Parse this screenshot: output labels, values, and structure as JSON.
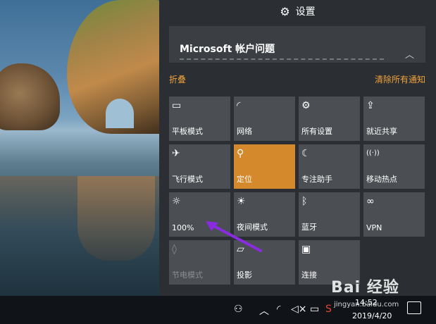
{
  "header": {
    "title": "设置",
    "gear_icon": "gear-icon"
  },
  "notification": {
    "title": "Microsoft 帐户问题",
    "chevron_icon": "chevron-up-icon"
  },
  "collapse": {
    "label": "折叠",
    "clear_all": "清除所有通知",
    "accent": "#f0a23b"
  },
  "tiles": [
    {
      "label": "平板模式",
      "icon": "tablet-mode-icon",
      "glyph": "▭",
      "active": false,
      "disabled": false
    },
    {
      "label": "网络",
      "icon": "network-icon",
      "glyph": "◜",
      "active": false,
      "disabled": false
    },
    {
      "label": "所有设置",
      "icon": "settings-icon",
      "glyph": "⚙",
      "active": false,
      "disabled": false
    },
    {
      "label": "就近共享",
      "icon": "share-icon",
      "glyph": "⇪",
      "active": false,
      "disabled": false
    },
    {
      "label": "飞行模式",
      "icon": "airplane-icon",
      "glyph": "✈",
      "active": false,
      "disabled": false
    },
    {
      "label": "定位",
      "icon": "location-icon",
      "glyph": "⚲",
      "active": true,
      "disabled": false
    },
    {
      "label": "专注助手",
      "icon": "moon-icon",
      "glyph": "☾",
      "active": false,
      "disabled": false
    },
    {
      "label": "移动热点",
      "icon": "hotspot-icon",
      "glyph": "((·))",
      "active": false,
      "disabled": false
    },
    {
      "label": "100%",
      "icon": "brightness-icon",
      "glyph": "☼",
      "active": false,
      "disabled": false
    },
    {
      "label": "夜间模式",
      "icon": "night-light-icon",
      "glyph": "☀",
      "active": false,
      "disabled": false
    },
    {
      "label": "蓝牙",
      "icon": "bluetooth-icon",
      "glyph": "ᛒ",
      "active": false,
      "disabled": false
    },
    {
      "label": "VPN",
      "icon": "vpn-icon",
      "glyph": "∞",
      "active": false,
      "disabled": false
    },
    {
      "label": "节电模式",
      "icon": "battery-saver-icon",
      "glyph": "◊",
      "active": false,
      "disabled": true
    },
    {
      "label": "投影",
      "icon": "project-icon",
      "glyph": "▱",
      "active": false,
      "disabled": false
    },
    {
      "label": "连接",
      "icon": "connect-icon",
      "glyph": "▣",
      "active": false,
      "disabled": false
    }
  ],
  "colors": {
    "active_tile": "#d48a2c",
    "tile": "#4b4f53",
    "panel": "#2b2f33"
  },
  "taskbar": {
    "time": "14:52",
    "date": "2019/4/20",
    "tray_icons": [
      "people-icon",
      "chevron-up-icon",
      "wifi-icon",
      "volume-muted-icon",
      "battery-icon",
      "input-method-icon"
    ]
  },
  "watermark": {
    "logo": "Bai 经验",
    "url": "jingyan.baidu.com"
  }
}
